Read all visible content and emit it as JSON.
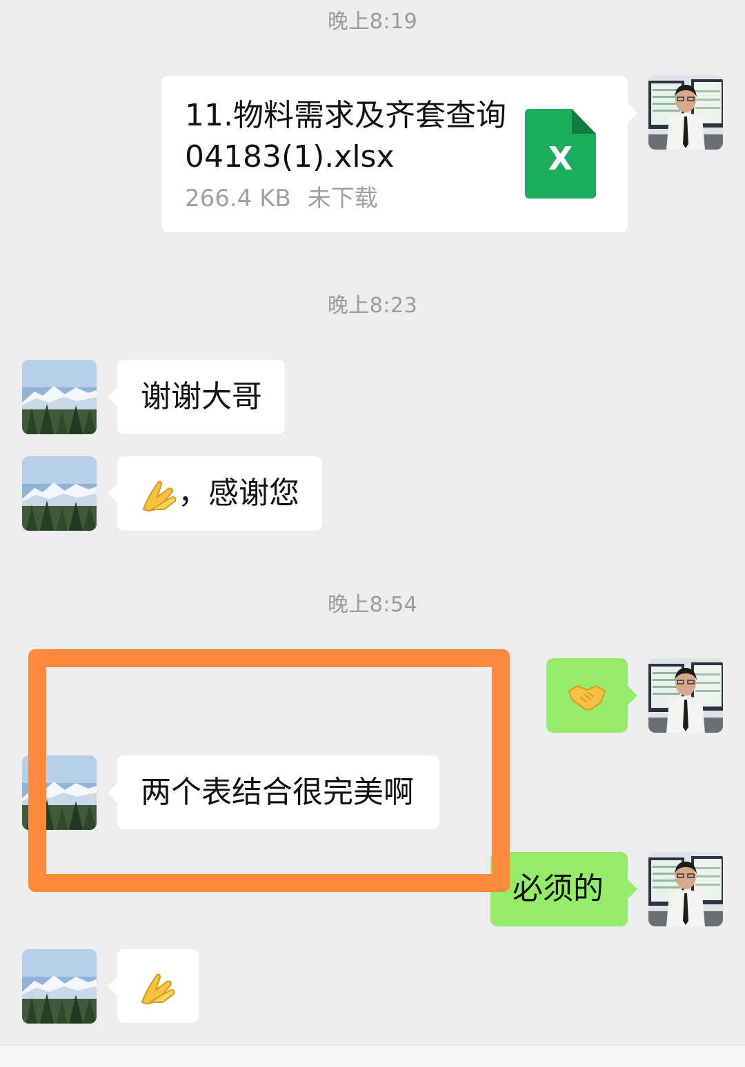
{
  "chat": {
    "time_1": "晚上8:19",
    "time_2": "晚上8:23",
    "time_3": "晚上8:54",
    "file": {
      "name": "11.物料需求及齐套查询04183(1).xlsx",
      "size": "266.4 KB",
      "status": "未下载",
      "icon": "excel-file-icon",
      "icon_letter": "X"
    },
    "messages": {
      "m1": "谢谢大哥",
      "m2_emoji": "folded-hands-emoji",
      "m2_text": "，感谢您",
      "m3_emoji": "handshake-emoji",
      "m4": "两个表结合很完美啊",
      "m5": "必须的",
      "m6_emoji": "folded-hands-emoji"
    }
  },
  "colors": {
    "background": "#ededed",
    "bubble_self": "#95ec69",
    "bubble_other": "#ffffff",
    "timestamp": "#9b9b9b",
    "highlight_frame": "#ff8a3c",
    "excel_green": "#1aad5b"
  }
}
